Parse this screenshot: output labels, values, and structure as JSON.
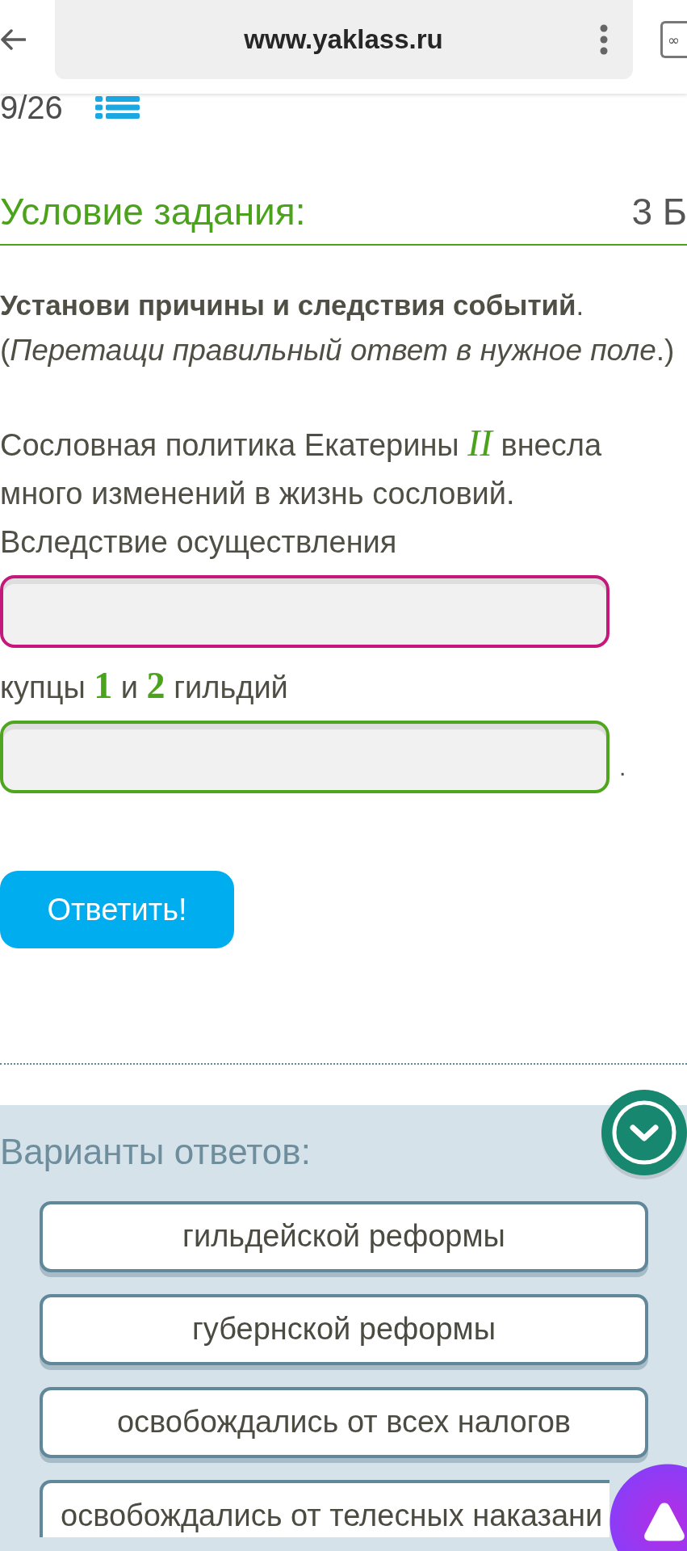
{
  "browser": {
    "url": "www.yaklass.ru",
    "tab_count": "∞"
  },
  "progress": {
    "text": "9/26"
  },
  "section": {
    "title": "Условие задания:",
    "points": "3 Б"
  },
  "task": {
    "instruction": "**Установи причины и следствия событий**.",
    "hint": "(*Перетащи правильный ответ в нужное поле*.)",
    "parts": [
      {
        "kind": "text",
        "text": "Сословная политика Екатерины *II* внесла много изменений в жизнь сословий. Вследствие осуществления"
      },
      {
        "kind": "dropzone",
        "color": "#c4187c"
      },
      {
        "kind": "text",
        "text": "купцы **1** и **2** гильдий"
      },
      {
        "kind": "dropzone",
        "color": "#4ea51e",
        "suffix": "."
      }
    ]
  },
  "submit": {
    "label": "Ответить!"
  },
  "answers": {
    "title": "Варианты ответов:",
    "options": [
      "гильдейской реформы",
      "губернской реформы",
      "освобождались от всех налогов",
      "освобождались от телесных наказани"
    ]
  }
}
